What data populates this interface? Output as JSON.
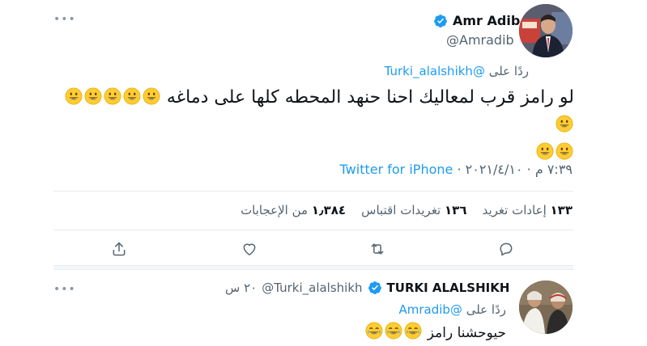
{
  "main_tweet": {
    "display_name": "Amr Adib",
    "handle": "@Amradib",
    "reply_prefix": "ردًا على",
    "reply_to": "@Turki_alalshikh",
    "text": "لو رامز قرب لمعاليك احنا حنهد المحطه كلها على دماغه",
    "emoji_count_line1": 6,
    "emoji_count_line2": 2,
    "timestamp": "٧:٣٩ م · ٢٠٢١/٤/١٠",
    "separator": "·",
    "source": "Twitter for iPhone",
    "stats": {
      "retweets_count": "١٣٣",
      "retweets_label": "إعادات تغريد",
      "quotes_count": "١٣٦",
      "quotes_label": "تغريدات اقتباس",
      "likes_count": "١٫٣٨٤",
      "likes_label": "من الإعجابات"
    },
    "actions": [
      "reply-icon",
      "retweet-icon",
      "like-icon",
      "share-icon"
    ]
  },
  "reply_tweet": {
    "display_name": "TURKI ALALSHIKH",
    "handle": "@Turki_alalshikh",
    "time": "٢٠ س",
    "reply_prefix": "ردًا على",
    "reply_to": "@Amradib",
    "text": "حيوحشنا رامز",
    "emoji_count": 3
  },
  "colors": {
    "accent": "#1d9bf0",
    "secondary_text": "#536471",
    "primary_text": "#0f1419",
    "divider": "#e6ecf0"
  }
}
